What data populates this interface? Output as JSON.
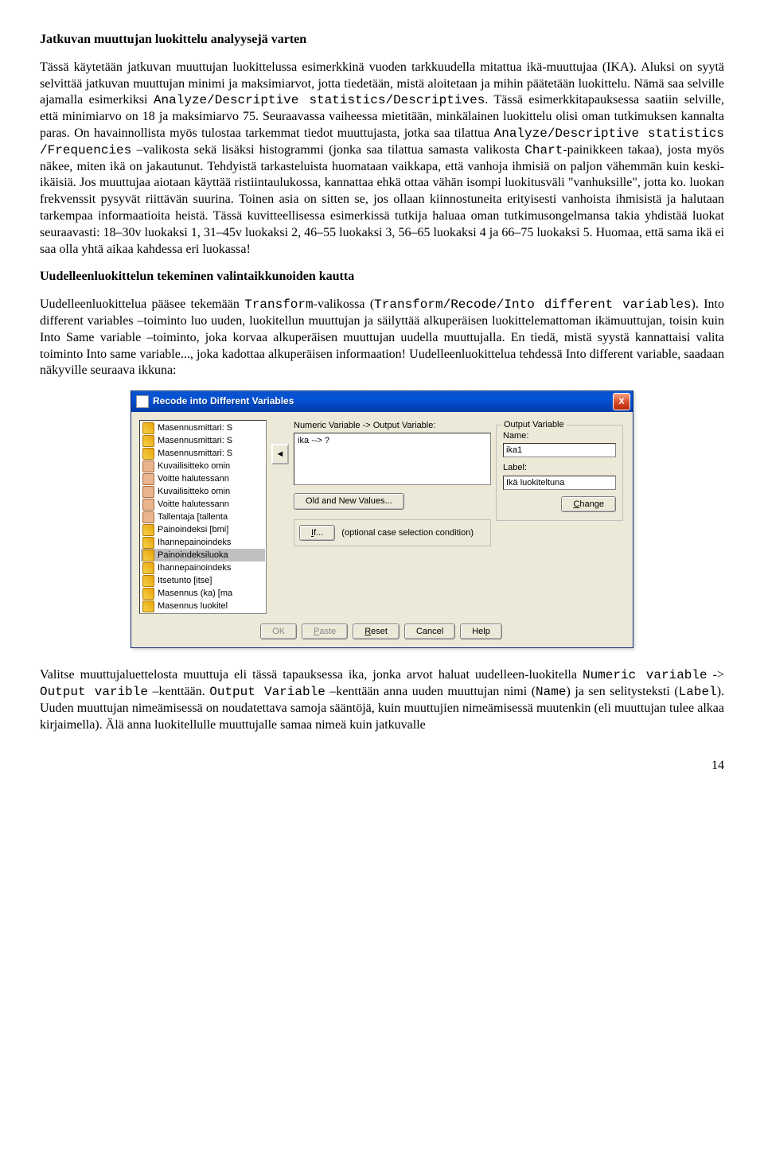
{
  "heading1": "Jatkuvan muuttujan luokittelu analyysejä varten",
  "para1a": "Tässä käytetään jatkuvan muuttujan luokittelussa esimerkkinä vuoden tarkkuudella mitattua ikä-muuttujaa (IKA). Aluksi on syytä selvittää jatkuvan muuttujan minimi ja maksimiarvot, jotta tiedetään, mistä aloitetaan ja mihin päätetään luokittelu. Nämä saa selville ajamalla esimerkiksi ",
  "code1": "Analyze/Descriptive statistics/Descriptives",
  "para1b": ". Tässä esimerkkitapauksessa saatiin selville, että minimiarvo on 18 ja maksimiarvo 75. Seuraavassa vaiheessa mietitään, minkälainen luokittelu olisi oman tutkimuksen kannalta paras. On havainnollista myös tulostaa tarkemmat tiedot muuttujasta, jotka saa tilattua ",
  "code2": "Analyze/Descriptive statistics /Frequencies",
  "para1c": " –valikosta  sekä lisäksi histogrammi (jonka saa tilattua samasta valikosta ",
  "code3": "Chart",
  "para1d": "-painikkeen takaa), josta myös näkee, miten ikä on jakautunut. Tehdyistä tarkasteluista huomataan vaikkapa, että vanhoja ihmisiä on paljon vähemmän kuin keski-ikäisiä. Jos muuttujaa aiotaan käyttää ristiintaulukossa, kannattaa ehkä ottaa vähän isompi luokitusväli \"vanhuksille\", jotta ko. luokan frekvenssit pysyvät riittävän suurina. Toinen asia on sitten se, jos ollaan kiinnostuneita erityisesti vanhoista ihmisistä ja halutaan tarkempaa informaatioita heistä. Tässä kuvitteellisessa esimerkissä tutkija haluaa oman tutkimusongelmansa takia yhdistää luokat seuraavasti: 18–30v luokaksi 1, 31–45v luokaksi 2, 46–55 luokaksi 3, 56–65 luokaksi 4 ja 66–75 luokaksi 5. Huomaa, että sama ikä ei saa olla yhtä aikaa kahdessa eri luokassa!",
  "heading2": "Uudelleenluokittelun tekeminen valintaikkunoiden kautta",
  "para2a": "Uudelleenluokittelua pääsee tekemään ",
  "code4": "Transform",
  "para2a2": "-valikossa (",
  "code5": "Transform/Recode/Into different variables",
  "para2a3": "). Into different variables –toiminto luo uuden, luokitellun muuttujan ja säilyttää alkuperäisen luokittelemattoman ikämuuttujan, toisin kuin Into Same variable –toiminto, joka korvaa alkuperäisen muuttujan uudella muuttujalla. En tiedä, mistä syystä kannattaisi valita toiminto Into same variable..., joka kadottaa alkuperäisen informaation! Uudelleenluokittelua tehdessä Into different variable, saadaan näkyville seuraava ikkuna:",
  "para3a": "Valitse muuttujaluettelosta muuttuja eli tässä tapauksessa ika, jonka arvot haluat uudelleen-luokitella ",
  "code6": "Numeric variable",
  "para3b": " -> ",
  "code7": "Output varible",
  "para3c": " –kenttään. ",
  "code8": "Output Variable",
  "para3d": " –kenttään anna uuden muuttujan nimi (",
  "code9": "Name",
  "para3e": ") ja sen selitysteksti (",
  "code10": "Label",
  "para3f": "). Uuden muuttujan nimeämisessä on noudatettava samoja sääntöjä, kuin muuttujien nimeämisessä muutenkin (eli muuttujan tulee alkaa kirjaimella). Älä anna luokitellulle muuttujalle samaa nimeä kuin jatkuvalle",
  "pagenum": "14",
  "dialog": {
    "title": "Recode into Different Variables",
    "close": "X",
    "numeric_label": "Numeric Variable -> Output Variable:",
    "numeric_value": "ika --> ?",
    "old_new_btn": "Old and New Values...",
    "if_btn": "If...",
    "if_label": "(optional case selection condition)",
    "group_title": "Output Variable",
    "name_label": "Name:",
    "name_value": "ika1",
    "label_label": "Label:",
    "label_value": "Ikä luokiteltuna",
    "change_btn": "Change",
    "move_arrow": "◄",
    "btns": {
      "ok": "OK",
      "paste": "Paste",
      "reset": "Reset",
      "cancel": "Cancel",
      "help": "Help"
    },
    "vars": [
      {
        "icon": "scale",
        "label": "Masennusmittari: S"
      },
      {
        "icon": "scale",
        "label": "Masennusmittari: S"
      },
      {
        "icon": "scale",
        "label": "Masennusmittari: S"
      },
      {
        "icon": "nominal",
        "label": "Kuvailisitteko omin"
      },
      {
        "icon": "nominal",
        "label": "Voitte halutessann"
      },
      {
        "icon": "nominal",
        "label": "Kuvailisitteko omin"
      },
      {
        "icon": "nominal",
        "label": "Voitte halutessann"
      },
      {
        "icon": "nominal",
        "label": "Tallentaja [tallenta"
      },
      {
        "icon": "scale",
        "label": "Painoindeksi [bmi]"
      },
      {
        "icon": "scale",
        "label": "Ihannepainoindeks"
      },
      {
        "icon": "scale",
        "label": "Painoindeksiluoka",
        "sel": true
      },
      {
        "icon": "scale",
        "label": "Ihannepainoindeks"
      },
      {
        "icon": "scale",
        "label": "Itsetunto [itse]"
      },
      {
        "icon": "scale",
        "label": "Masennus (ka) [ma"
      },
      {
        "icon": "scale",
        "label": "Masennus luokitel"
      }
    ]
  }
}
